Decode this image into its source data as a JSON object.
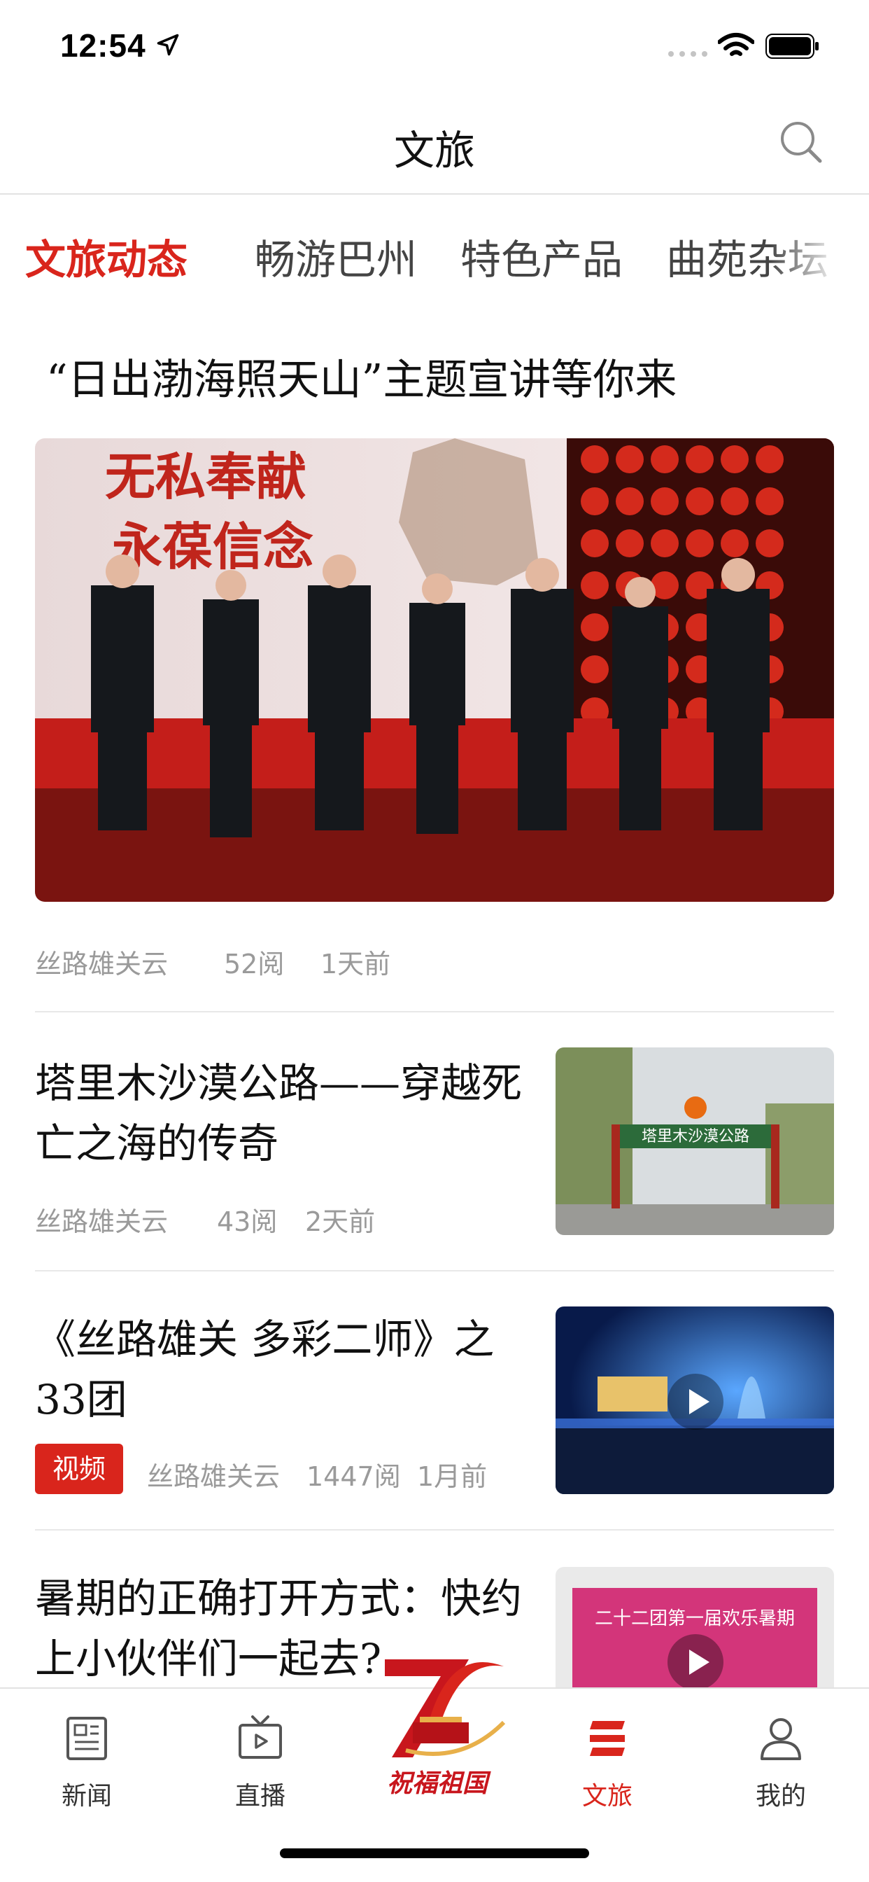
{
  "status_bar": {
    "time": "12:54"
  },
  "header": {
    "title": "文旅"
  },
  "tabs": [
    {
      "label": "文旅动态",
      "active": true
    },
    {
      "label": "畅游巴州",
      "active": false
    },
    {
      "label": "特色产品",
      "active": false
    },
    {
      "label": "曲苑杂坛",
      "active": false
    }
  ],
  "feature": {
    "title": "“日出渤海照天山”主题宣讲等你来",
    "image_text_line1": "无私奉献",
    "image_text_line2": "永葆信念",
    "source": "丝路雄关云",
    "reads": "52阅",
    "time": "1天前"
  },
  "articles": [
    {
      "title": "塔里木沙漠公路——穿越死亡之海的传奇",
      "source": "丝路雄关云",
      "reads": "43阅",
      "time": "2天前",
      "thumb_text": "塔里木沙漠公路"
    },
    {
      "title": "《丝路雄关 多彩二师》之33团",
      "badge": "视频",
      "source": "丝路雄关云",
      "reads": "1447阅",
      "time": "1月前"
    },
    {
      "title": "暑期的正确打开方式：快约上小伙伴们一起去?...",
      "thumb_text": "二十二团第一届欢乐暑期"
    }
  ],
  "tabbar": {
    "items": [
      {
        "label": "新闻",
        "icon": "newspaper-icon"
      },
      {
        "label": "直播",
        "icon": "tv-icon"
      },
      {
        "label": "文旅",
        "icon": "wenlv-icon",
        "active": true
      },
      {
        "label": "我的",
        "icon": "person-icon"
      }
    ],
    "center_logo_text": "祝福祖国"
  },
  "colors": {
    "accent": "#d9251c",
    "meta": "#9a9a9a"
  }
}
